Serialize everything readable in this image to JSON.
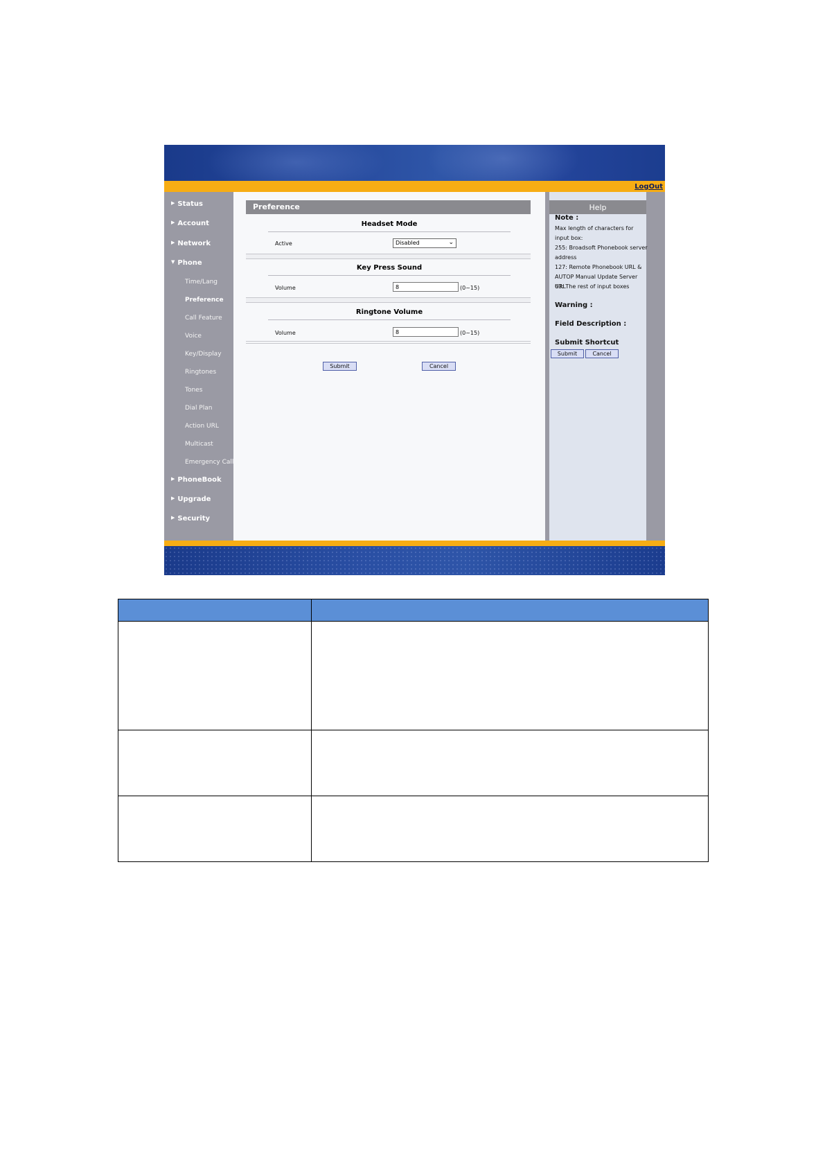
{
  "screenshot": {
    "logout_label": "LogOut",
    "nav": [
      {
        "label": "Status",
        "arrow": "▶"
      },
      {
        "label": "Account",
        "arrow": "▶"
      },
      {
        "label": "Network",
        "arrow": "▶"
      },
      {
        "label": "Phone",
        "arrow": "▼"
      },
      {
        "label": "PhoneBook",
        "arrow": "▶"
      },
      {
        "label": "Upgrade",
        "arrow": "▶"
      },
      {
        "label": "Security",
        "arrow": "▶"
      }
    ],
    "sub_nav": [
      "Time/Lang",
      "Preference",
      "Call Feature",
      "Voice",
      "Key/Display",
      "Ringtones",
      "Tones",
      "Dial Plan",
      "Action URL",
      "Multicast",
      "Emergency Call"
    ],
    "active_sub": "Preference",
    "content": {
      "title": "Preference",
      "sections": [
        {
          "title": "Headset Mode",
          "field_label": "Active",
          "value": "Disabled",
          "type": "select"
        },
        {
          "title": "Key Press Sound",
          "field_label": "Volume",
          "value": "8",
          "range": "(0~15)",
          "type": "input"
        },
        {
          "title": "Ringtone Volume",
          "field_label": "Volume",
          "value": "8",
          "range": "(0~15)",
          "type": "input"
        }
      ],
      "submit_label": "Submit",
      "cancel_label": "Cancel"
    },
    "help": {
      "title": "Help",
      "note_label": "Note :",
      "note_lines": [
        "Max length of characters for input box:",
        "255: Broadsoft Phonebook server address",
        "127: Remote Phonebook URL & AUTOP Manual Update Server URL",
        "63: The rest of input boxes"
      ],
      "warning_label": "Warning :",
      "field_desc_label": "Field Description :",
      "shortcut_label": "Submit Shortcut",
      "submit_label": "Submit",
      "cancel_label": "Cancel"
    },
    "colors": {
      "banner": "#23449a",
      "accent": "#f7ad14",
      "sidebar": "#9a9aa4"
    }
  },
  "table": {
    "header_color": "#5b8fd6",
    "headers": [
      "",
      ""
    ],
    "rows": [
      [
        "",
        ""
      ],
      [
        "",
        ""
      ],
      [
        "",
        ""
      ]
    ]
  }
}
